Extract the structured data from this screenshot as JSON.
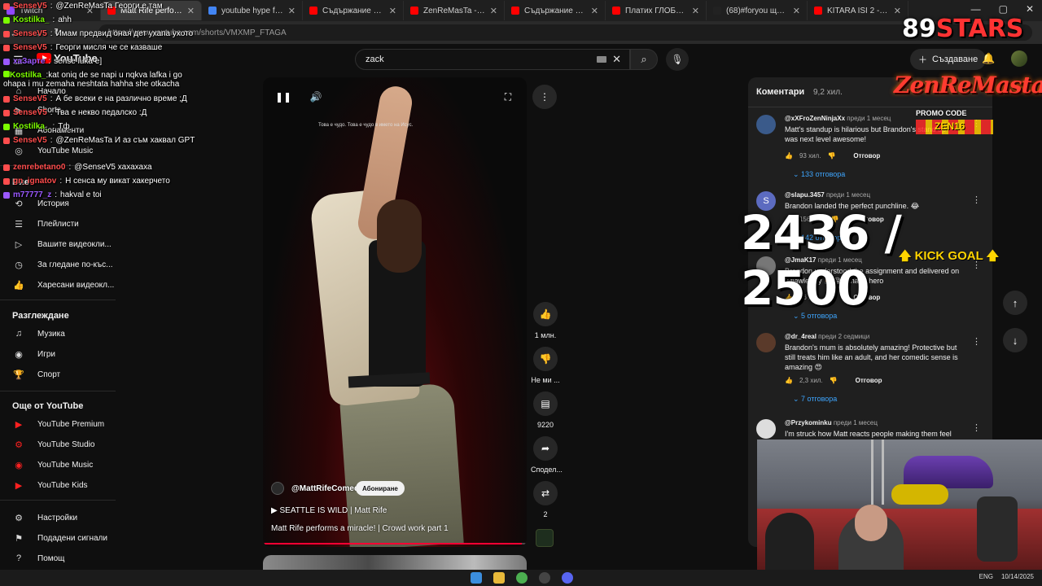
{
  "browser": {
    "tabs": [
      {
        "title": "Twitch",
        "color": "#9146ff"
      },
      {
        "title": "Matt Rife performs a",
        "color": "#ff0000"
      },
      {
        "title": "youtube hype from pc",
        "color": "#4285f4"
      },
      {
        "title": "Съдържание на канал",
        "color": "#ff0000"
      },
      {
        "title": "ZenReMasTa - YouTube",
        "color": "#ff0000"
      },
      {
        "title": "Съдържание на канал",
        "color": "#ff0000"
      },
      {
        "title": "Платих ГЛОБИ за над",
        "color": "#ff0000"
      },
      {
        "title": "(68)#foryou ще пусна",
        "color": "#222222"
      },
      {
        "title": "KITARA ISI 2 - METIN",
        "color": "#ff0000"
      }
    ],
    "url": "https://www.youtube.com/shorts/VMXMP_FTAGA"
  },
  "youtube": {
    "logo_text": "YouTube",
    "search_value": "zack",
    "create_label": "Създаване"
  },
  "sidebar": {
    "top_items": [
      {
        "label": "Начало",
        "icon": "home-icon"
      },
      {
        "label": "Shorts",
        "icon": "shorts-icon"
      },
      {
        "label": "Абонаменти",
        "icon": "subscriptions-icon"
      },
      {
        "label": "YouTube Music",
        "icon": "music-icon"
      }
    ],
    "you_heading": "Вие",
    "you_items": [
      {
        "label": "История",
        "icon": "history-icon"
      },
      {
        "label": "Плейлисти",
        "icon": "playlists-icon"
      },
      {
        "label": "Вашите видеокли...",
        "icon": "your-videos-icon"
      },
      {
        "label": "За гледане по-къс...",
        "icon": "watch-later-icon"
      },
      {
        "label": "Харесани видеокл...",
        "icon": "liked-icon"
      }
    ],
    "explore_heading": "Разглеждане",
    "explore_items": [
      {
        "label": "Музика",
        "icon": "music-note-icon"
      },
      {
        "label": "Игри",
        "icon": "gaming-icon"
      },
      {
        "label": "Спорт",
        "icon": "trophy-icon"
      }
    ],
    "more_heading": "Още от YouTube",
    "more_items": [
      {
        "label": "YouTube Premium",
        "icon": "youtube-premium-icon"
      },
      {
        "label": "YouTube Studio",
        "icon": "youtube-studio-icon"
      },
      {
        "label": "YouTube Music",
        "icon": "youtube-music-icon"
      },
      {
        "label": "YouTube Kids",
        "icon": "youtube-kids-icon"
      }
    ],
    "bottom_items": [
      {
        "label": "Настройки",
        "icon": "settings-icon"
      },
      {
        "label": "Подадени сигнали",
        "icon": "flag-icon"
      },
      {
        "label": "Помощ",
        "icon": "help-icon"
      }
    ]
  },
  "chat": [
    {
      "user": "SenseV5",
      "color": "#ff4d4d",
      "msg": "@ZenReMasTa Георги е там"
    },
    {
      "user": "Kostilka_",
      "color": "#7cfc00",
      "msg": "ahh"
    },
    {
      "user": "SenseV5",
      "color": "#ff4d4d",
      "msg": "Имам предвид оная дет ухапа ухото"
    },
    {
      "user": "SenseV5",
      "color": "#ff4d4d",
      "msg": "Георги мисля че се казваше"
    },
    {
      "user": "xaЗарте",
      "color": "#9b59ff",
      "msg": "sense luka e]"
    },
    {
      "user": "Kostilka_",
      "color": "#7cfc00",
      "msg": "kat oniq de se napi u nqkva lafka i go ohapa i mu zemaha neshtata hahha she otkacha"
    },
    {
      "user": "SenseV5",
      "color": "#ff4d4d",
      "msg": "А бе всеки е на различно време ;Д"
    },
    {
      "user": "SenseV5",
      "color": "#ff4d4d",
      "msg": "Тва е некво педалско :Д"
    },
    {
      "user": "Kostilka_",
      "color": "#7cfc00",
      "msg": "Тф"
    },
    {
      "user": "SenseV5",
      "color": "#ff4d4d",
      "msg": "@ZenReMasTa И аз съм хаквал GPT"
    },
    {
      "user": "zenrebetano0",
      "color": "#ff4d4d",
      "msg": "@SenseV5 хахахаха"
    },
    {
      "user": "gn_ignatov",
      "color": "#ff4d4d",
      "msg": "Н сенса му викат хакерчето"
    },
    {
      "user": "m77777_z",
      "color": "#9b59ff",
      "msg": "hakval e toi"
    }
  ],
  "video": {
    "caption": "Това е чудо. Това е чудо в името на Исус.",
    "channel": "@MattRifeComedy",
    "subscribe_label": "Абониране",
    "playlist": "SEATTLE IS WILD | Matt Rife",
    "title": "Matt Rife performs a miracle! | Crowd work  part 1",
    "progress": 0.98
  },
  "actions": {
    "likes": "1 млн.",
    "dislike": "Не ми ...",
    "comments": "9220",
    "share": "Сподел...",
    "remix": "2"
  },
  "comments": {
    "title": "Коментари",
    "count": "9,2 хил.",
    "items": [
      {
        "handle": "@xXFroZenNinjaXx",
        "time": "преди 1 месец",
        "text": "Matt's standup is hilarious but Brandon's stand up was next level awesome!",
        "likes": "93 хил.",
        "reply": "Отговор",
        "replies": "133 отговора",
        "avatar_color": "#3a5a8a",
        "avatar_letter": ""
      },
      {
        "handle": "@slapu.3457",
        "time": "преди 1 месец",
        "text": "Brandon landed the perfect punchline. 😂",
        "likes": "156 хил.",
        "reply": "Отговор",
        "replies": "142 отговора",
        "avatar_color": "#5c6bc0",
        "avatar_letter": "S"
      },
      {
        "handle": "@JmaK17",
        "time": "преди 1 месец",
        "text": "Brandon understood the assignment and delivered on it flawlessly 👏🏻😂  What a hero",
        "likes": "16 хил.",
        "reply": "Отговор",
        "replies": "5 отговора",
        "avatar_color": "#777777",
        "avatar_letter": ""
      },
      {
        "handle": "@dr_4real",
        "time": "преди 2 седмици",
        "text": "Brandon's mum is absolutely amazing! Protective but still treats him like an adult, and her comedic sense is amazing 😍",
        "likes": "2,3 хил.",
        "reply": "Отговор",
        "replies": "7 отговора",
        "avatar_color": "#5a3a2a",
        "avatar_letter": ""
      },
      {
        "handle": "@Przykominku",
        "time": "преди 1 месец",
        "text": "I'm struck how Matt reacts people making them feel",
        "likes": "",
        "reply": "",
        "replies": "",
        "avatar_color": "#dddddd",
        "avatar_letter": ""
      }
    ]
  },
  "overlay": {
    "stars_number": "89",
    "stars_word": "STARS",
    "brand": "ZenReMasta",
    "promo_label": "PROMO CODE",
    "promo_code": "ZEN16",
    "goal_current": 2436,
    "goal_total": 2500,
    "goal_text": "2436 / 2500",
    "kick_goal": "KICK GOAL"
  },
  "taskbar": {
    "lang": "ENG",
    "date": "10/14/2025"
  }
}
